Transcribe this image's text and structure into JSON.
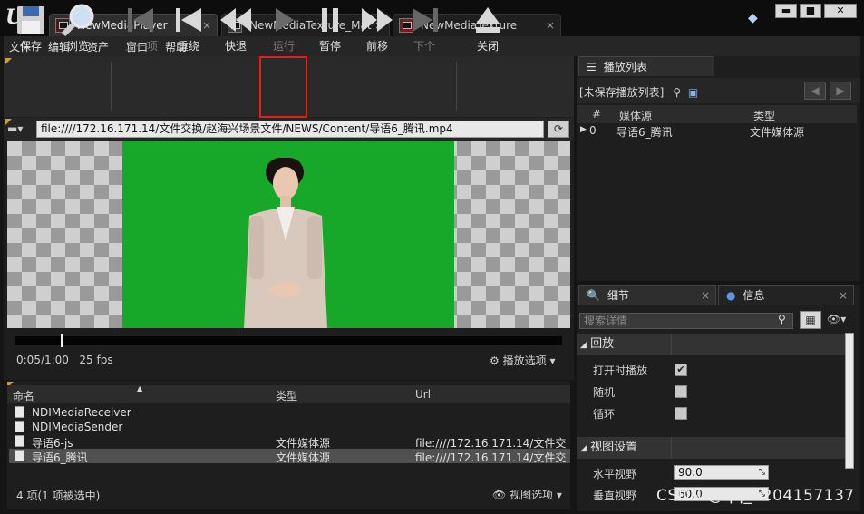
{
  "tabs": [
    {
      "label": "NewMediaPlayer",
      "close": "×"
    },
    {
      "label": "NewMediaTexture_Mat",
      "close": "×"
    },
    {
      "label": "NewMediaTexture",
      "close": "×"
    }
  ],
  "window_buttons": {
    "minimize": "▬",
    "maximize": "■",
    "close": "✕"
  },
  "menu": [
    "文件",
    "编辑",
    "资产",
    "窗口",
    "帮助"
  ],
  "toolbar": {
    "save": "保存",
    "browse": "浏览",
    "previous": "上一项",
    "rewind": "重绕",
    "reverse": "快退",
    "play": "运行",
    "pause": "暂停",
    "forward": "前移",
    "next": "下个",
    "close": "关闭"
  },
  "url": "file:////172.16.171.14/文件交换/赵海兴场景文件/NEWS/Content/导语6_腾讯.mp4",
  "playback": {
    "time": "0:05/1:00",
    "fps": "25 fps",
    "options_label": "播放选项",
    "progress_fraction": 0.085
  },
  "media_list": {
    "headers": {
      "name": "命名",
      "type": "类型",
      "url": "Url"
    },
    "rows": [
      {
        "name": "NDIMediaReceiver",
        "type": "",
        "url": ""
      },
      {
        "name": "NDIMediaSender",
        "type": "",
        "url": ""
      },
      {
        "name": "导语6-js",
        "type": "文件媒体源",
        "url": "file:////172.16.171.14/文件交"
      },
      {
        "name": "导语6_腾讯",
        "type": "文件媒体源",
        "url": "file:////172.16.171.14/文件交"
      }
    ],
    "selected_index": 3,
    "status": "4 项(1 项被选中)",
    "view_options": "视图选项"
  },
  "playlist": {
    "tab_label": "播放列表",
    "name": "[未保存播放列表]",
    "headers": {
      "index": "#",
      "source": "媒体源",
      "type": "类型"
    },
    "rows": [
      {
        "index": "0",
        "source": "导语6_腾讯",
        "type": "文件媒体源"
      }
    ]
  },
  "details": {
    "tab_details": "细节",
    "tab_info": "信息",
    "search_placeholder": "搜索详情",
    "categories": {
      "playback": "回放",
      "view": "视图设置"
    },
    "props": {
      "play_on_open": {
        "label": "打开时播放",
        "checked": true
      },
      "shuffle": {
        "label": "随机",
        "checked": false
      },
      "loop": {
        "label": "循环",
        "checked": false
      },
      "hfov": {
        "label": "水平视野",
        "value": "90.0"
      },
      "vfov": {
        "label": "垂直视野",
        "value": "60.0"
      }
    }
  },
  "watermark": "CSDN @qq_1204157137"
}
